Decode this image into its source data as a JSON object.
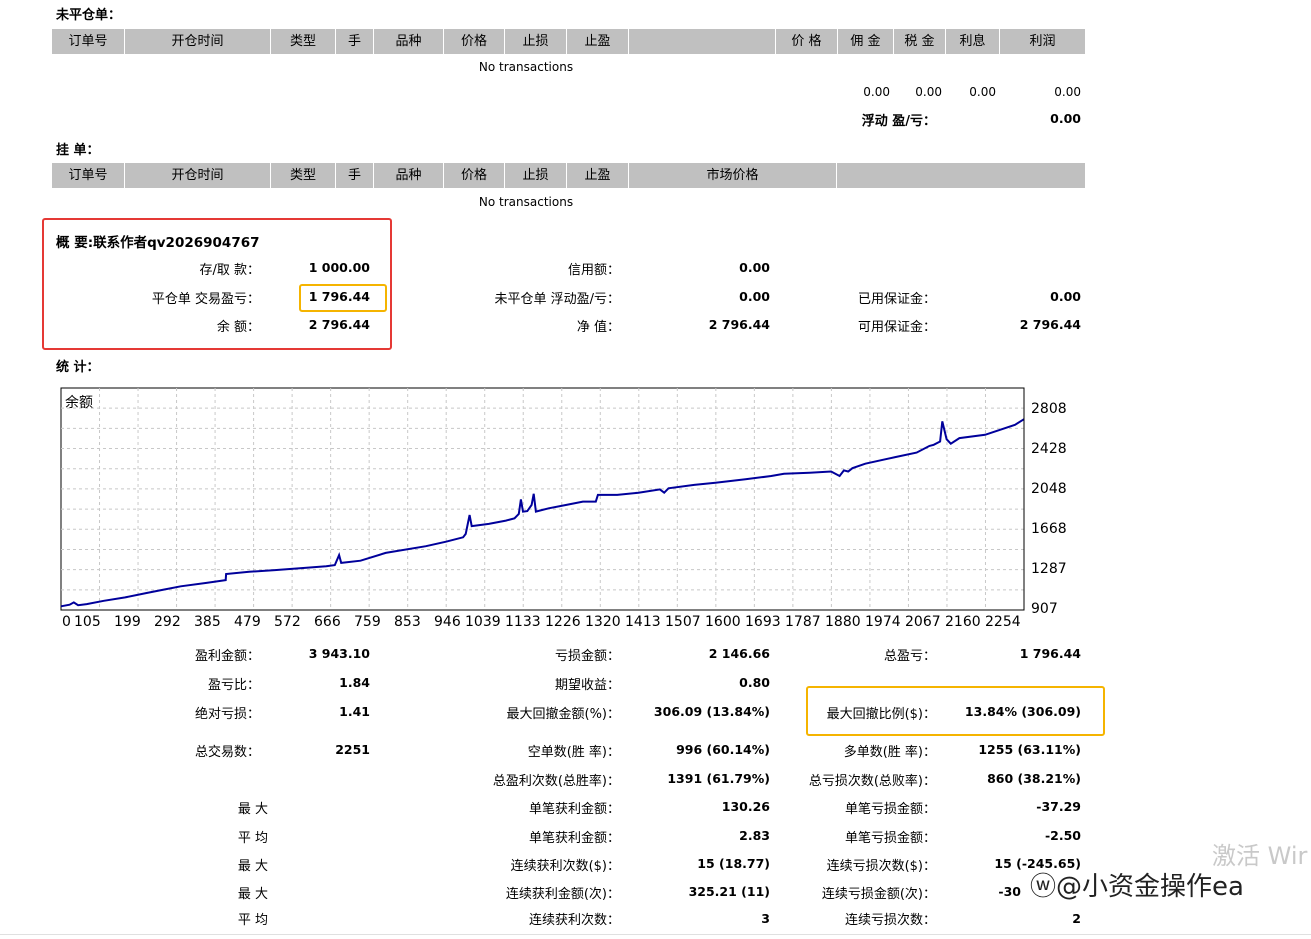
{
  "open_positions": {
    "title": "未平仓单：",
    "columns": [
      "订单号",
      "开仓时间",
      "类型",
      "手",
      "品种",
      "价格",
      "止损",
      "止盈",
      "",
      "价 格",
      "佣 金",
      "税 金",
      "利息",
      "利润"
    ],
    "empty_text": "No transactions",
    "totals": [
      "0.00",
      "0.00",
      "0.00",
      "0.00"
    ],
    "floating_label": "浮动 盈/亏：",
    "floating_value": "0.00"
  },
  "pending_orders": {
    "title": "挂 单：",
    "columns": [
      "订单号",
      "开仓时间",
      "类型",
      "手",
      "品种",
      "价格",
      "止损",
      "止盈",
      "市场价格",
      ""
    ],
    "empty_text": "No transactions"
  },
  "summary": {
    "title": "概 要:联系作者qv2026904767",
    "rows": [
      {
        "label": "存/取 款：",
        "value": "1 000.00"
      },
      {
        "label": "平仓单 交易盈亏：",
        "value": "1 796.44"
      },
      {
        "label": "余 额：",
        "value": "2 796.44"
      },
      {
        "label": "信用额：",
        "value": "0.00"
      },
      {
        "label": "未平仓单 浮动盈/亏：",
        "value": "0.00"
      },
      {
        "label": "净 值：",
        "value": "2 796.44"
      },
      {
        "label": "已用保证金：",
        "value": "0.00"
      },
      {
        "label": "可用保证金：",
        "value": "2 796.44"
      }
    ]
  },
  "stats_title": "统 计：",
  "chart_data": {
    "type": "line",
    "title": "余额",
    "x_ticks": [
      "0",
      "105",
      "199",
      "292",
      "385",
      "479",
      "572",
      "666",
      "759",
      "853",
      "946",
      "1039",
      "1133",
      "1226",
      "1320",
      "1413",
      "1507",
      "1600",
      "1693",
      "1787",
      "1880",
      "1974",
      "2067",
      "2160",
      "2254"
    ],
    "y_ticks": [
      "2808",
      "2428",
      "2048",
      "1668",
      "1287",
      "907"
    ],
    "ylim": [
      907,
      2900
    ],
    "xlim": [
      0,
      2251
    ],
    "color": "#00009b",
    "series": [
      {
        "x": [
          0,
          20,
          30,
          40,
          60,
          100,
          150,
          200,
          240,
          280,
          340,
          385,
          386,
          440,
          500,
          570,
          620,
          640,
          650,
          655,
          700,
          759,
          853,
          900,
          940,
          946,
          955,
          960,
          1000,
          1040,
          1060,
          1070,
          1075,
          1080,
          1090,
          1100,
          1105,
          1110,
          1120,
          1140,
          1180,
          1220,
          1250,
          1255,
          1300,
          1350,
          1400,
          1410,
          1420,
          1480,
          1530,
          1600,
          1660,
          1690,
          1750,
          1800,
          1820,
          1830,
          1840,
          1850,
          1880,
          1950,
          2000,
          2030,
          2040,
          2055,
          2060,
          2070,
          2080,
          2100,
          2160,
          2230,
          2251
        ],
        "y": [
          940,
          955,
          975,
          950,
          960,
          990,
          1020,
          1060,
          1090,
          1120,
          1150,
          1175,
          1230,
          1250,
          1265,
          1285,
          1300,
          1310,
          1400,
          1330,
          1350,
          1420,
          1480,
          1520,
          1560,
          1590,
          1760,
          1660,
          1680,
          1710,
          1730,
          1770,
          1900,
          1790,
          1795,
          1850,
          1950,
          1790,
          1800,
          1820,
          1850,
          1880,
          1880,
          1940,
          1940,
          1960,
          1990,
          1960,
          2000,
          2030,
          2050,
          2080,
          2110,
          2130,
          2140,
          2150,
          2110,
          2160,
          2150,
          2180,
          2220,
          2280,
          2320,
          2380,
          2390,
          2420,
          2600,
          2440,
          2400,
          2450,
          2480,
          2570,
          2620
        ]
      }
    ]
  },
  "stats": {
    "col1": [
      {
        "label": "盈利金额：",
        "value": "3 943.10"
      },
      {
        "label": "盈亏比：",
        "value": "1.84"
      },
      {
        "label": "绝对亏损：",
        "value": "1.41"
      },
      {
        "label": "总交易数：",
        "value": "2251"
      }
    ],
    "col2": [
      {
        "label": "亏损金额：",
        "value": "2 146.66"
      },
      {
        "label": "期望收益：",
        "value": "0.80"
      },
      {
        "label": "最大回撤金额(%)：",
        "value": "306.09 (13.84%)"
      },
      {
        "label": "空单数(胜 率)：",
        "value": "996 (60.14%)"
      },
      {
        "label": "总盈利次数(总胜率)：",
        "value": "1391 (61.79%)"
      },
      {
        "label": "单笔获利金额：",
        "value": "130.26"
      },
      {
        "label": "单笔获利金额：",
        "value": "2.83"
      },
      {
        "label": "连续获利次数($)：",
        "value": "15 (18.77)"
      },
      {
        "label": "连续获利金额(次)：",
        "value": "325.21 (11)"
      },
      {
        "label": "连续获利次数：",
        "value": "3"
      }
    ],
    "col3": [
      {
        "label": "总盈亏：",
        "value": "1 796.44"
      },
      {
        "label": "最大回撤比例($)：",
        "value": "13.84% (306.09)"
      },
      {
        "label": "多单数(胜 率)：",
        "value": "1255 (63.11%)"
      },
      {
        "label": "总亏损次数(总败率)：",
        "value": "860 (38.21%)"
      },
      {
        "label": "单笔亏损金额：",
        "value": "-37.29"
      },
      {
        "label": "单笔亏损金额：",
        "value": "-2.50"
      },
      {
        "label": "连续亏损次数($)：",
        "value": "15 (-245.65)"
      },
      {
        "label": "连续亏损金额(次)：",
        "value": "-30"
      },
      {
        "label": "连续亏损次数：",
        "value": "2"
      }
    ],
    "side_labels": [
      "最 大",
      "平 均",
      "最 大",
      "最 大",
      "平 均"
    ]
  },
  "watermarks": {
    "windows": "激活 Wir",
    "weibo": "ⓦ@小资金操作ea"
  }
}
